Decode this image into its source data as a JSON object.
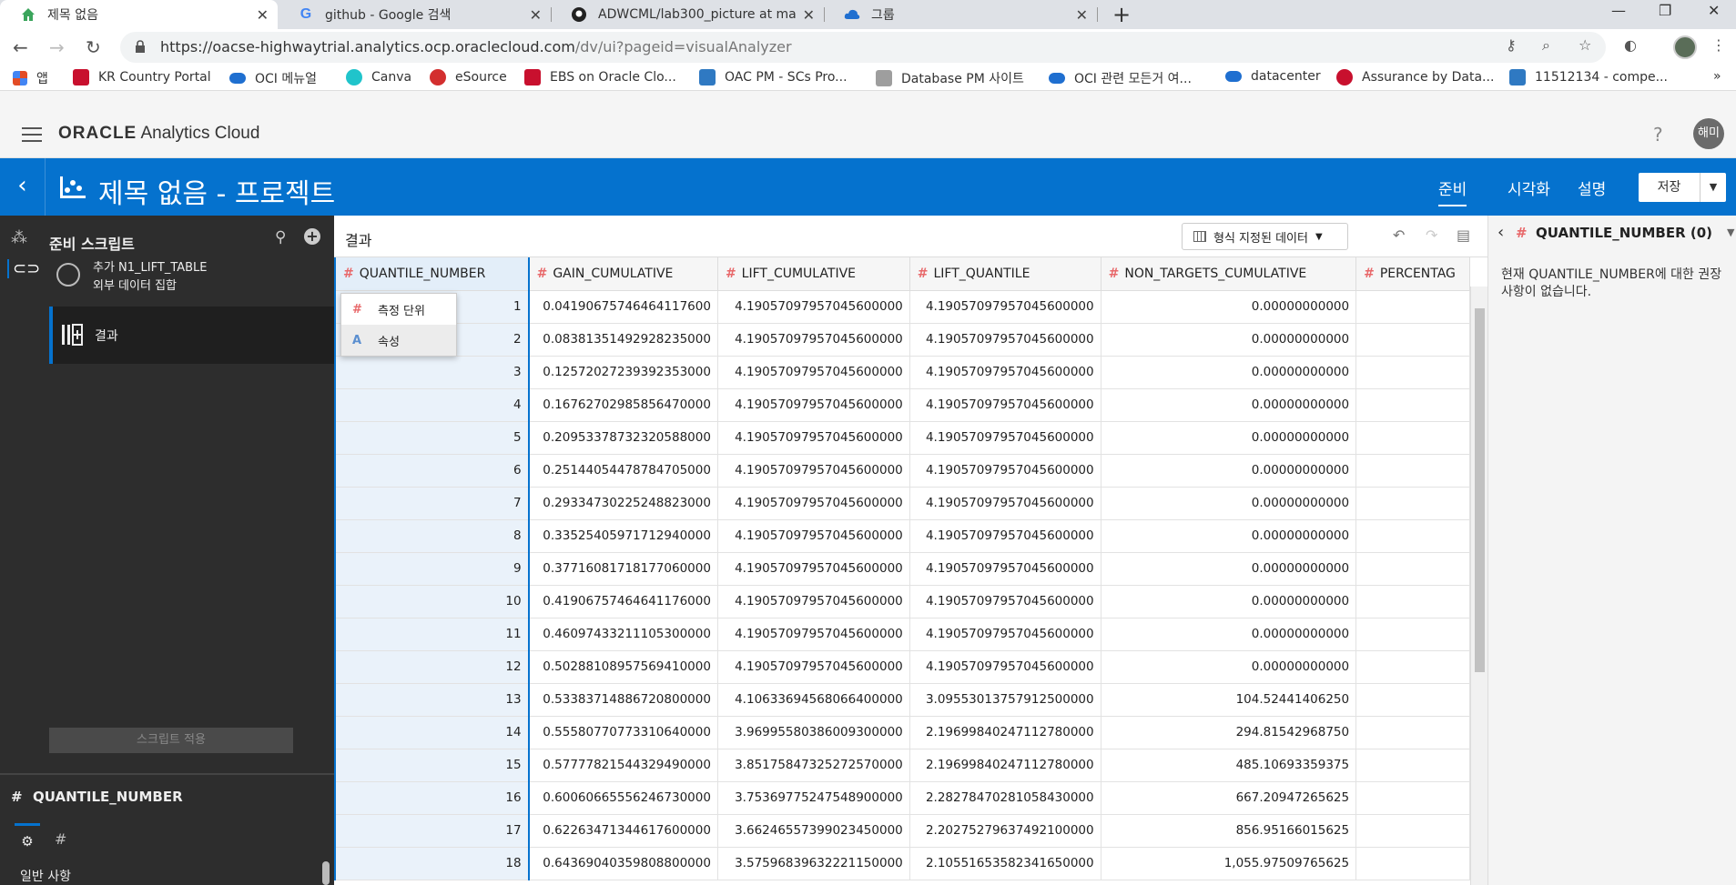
{
  "browser": {
    "tabs": [
      {
        "title": "제목 없음",
        "icon": "oac-home-icon",
        "active": true
      },
      {
        "title": "github - Google 검색",
        "icon": "google-icon",
        "active": false
      },
      {
        "title": "ADWCML/lab300_picture at ma",
        "icon": "github-icon",
        "active": false
      },
      {
        "title": "그룹",
        "icon": "cloud-icon",
        "active": false
      }
    ],
    "url_host": "https://oacse-highwaytrial.analytics.ocp.oraclecloud.com",
    "url_path": "/dv/ui?pageid=visualAnalyzer",
    "bookmarks": [
      {
        "label": "앱",
        "color": "#e34c26"
      },
      {
        "label": "KR Country Portal",
        "color": "#c8102e"
      },
      {
        "label": "OCI 메뉴얼",
        "color": "#1f6fd0"
      },
      {
        "label": "Canva",
        "color": "#20c4cb"
      },
      {
        "label": "eSource",
        "color": "#d32f2f"
      },
      {
        "label": "EBS on Oracle Clo...",
        "color": "#c8102e"
      },
      {
        "label": "OAC PM - SCs Pro...",
        "color": "#2f79c2"
      },
      {
        "label": "Database PM 사이트",
        "color": "#9e9e9e"
      },
      {
        "label": "OCI 관련 모든거 여...",
        "color": "#1f6fd0"
      },
      {
        "label": "datacenter",
        "color": "#1f6fd0"
      },
      {
        "label": "Assurance by Data...",
        "color": "#c8102e"
      },
      {
        "label": "11512134 - compe...",
        "color": "#2f79c2"
      }
    ]
  },
  "app": {
    "brand_oracle": "ORACLE",
    "brand_product": "Analytics Cloud",
    "help": "?",
    "user": "해미",
    "project_title": "제목 없음 - 프로젝트",
    "tabs": {
      "prepare": "준비",
      "visualize": "시각화",
      "narrate": "설명"
    },
    "save": "저장"
  },
  "left": {
    "title": "준비 스크립트",
    "step1_line1": "추가 N1_LIFT_TABLE",
    "step1_line2": "외부 데이터 집합",
    "step2_label": "결과",
    "apply": "스크립트 적용",
    "column_name": "QUANTILE_NUMBER",
    "general": "일반 사항"
  },
  "center": {
    "results_label": "결과",
    "format_button": "형식 지정된 데이터",
    "columns": [
      "QUANTILE_NUMBER",
      "GAIN_CUMULATIVE",
      "LIFT_CUMULATIVE",
      "LIFT_QUANTILE",
      "NON_TARGETS_CUMULATIVE",
      "PERCENTAG"
    ],
    "rows": [
      [
        "1",
        "0.04190675746464117600",
        "4.19057097957045600000",
        "4.19057097957045600000",
        "0.00000000000"
      ],
      [
        "2",
        "0.08381351492928235000",
        "4.19057097957045600000",
        "4.19057097957045600000",
        "0.00000000000"
      ],
      [
        "3",
        "0.12572027239392353000",
        "4.19057097957045600000",
        "4.19057097957045600000",
        "0.00000000000"
      ],
      [
        "4",
        "0.16762702985856470000",
        "4.19057097957045600000",
        "4.19057097957045600000",
        "0.00000000000"
      ],
      [
        "5",
        "0.20953378732320588000",
        "4.19057097957045600000",
        "4.19057097957045600000",
        "0.00000000000"
      ],
      [
        "6",
        "0.25144054478784705000",
        "4.19057097957045600000",
        "4.19057097957045600000",
        "0.00000000000"
      ],
      [
        "7",
        "0.29334730225248823000",
        "4.19057097957045600000",
        "4.19057097957045600000",
        "0.00000000000"
      ],
      [
        "8",
        "0.33525405971712940000",
        "4.19057097957045600000",
        "4.19057097957045600000",
        "0.00000000000"
      ],
      [
        "9",
        "0.37716081718177060000",
        "4.19057097957045600000",
        "4.19057097957045600000",
        "0.00000000000"
      ],
      [
        "10",
        "0.41906757464641176000",
        "4.19057097957045600000",
        "4.19057097957045600000",
        "0.00000000000"
      ],
      [
        "11",
        "0.46097433211105300000",
        "4.19057097957045600000",
        "4.19057097957045600000",
        "0.00000000000"
      ],
      [
        "12",
        "0.50288108957569410000",
        "4.19057097957045600000",
        "4.19057097957045600000",
        "0.00000000000"
      ],
      [
        "13",
        "0.53383714886720800000",
        "4.10633694568066400000",
        "3.09553013757912500000",
        "104.52441406250"
      ],
      [
        "14",
        "0.55580770773310640000",
        "3.96995580386009300000",
        "2.19699840247112780000",
        "294.81542968750"
      ],
      [
        "15",
        "0.57777821544329490000",
        "3.85175847325272570000",
        "2.19699840247112780000",
        "485.10693359375"
      ],
      [
        "16",
        "0.60060665556246730000",
        "3.75369775247548900000",
        "2.28278470281058430000",
        "667.20947265625"
      ],
      [
        "17",
        "0.62263471344617600000",
        "3.66246557399023450000",
        "2.20275279637492100000",
        "856.95166015625"
      ],
      [
        "18",
        "0.64369040359808800000",
        "3.57596839632221150000",
        "2.10551653582341650000",
        "1,055.97509765625"
      ]
    ],
    "popup": {
      "measure": "측정 단위",
      "attribute": "속성"
    }
  },
  "right": {
    "title": "QUANTILE_NUMBER (0)",
    "message": "현재 QUANTILE_NUMBER에 대한 권장 사항이 없습니다."
  },
  "colors": {
    "accent": "#0572ce",
    "measure_hash": "#e8686a",
    "left_panel": "#2d2d2d"
  }
}
